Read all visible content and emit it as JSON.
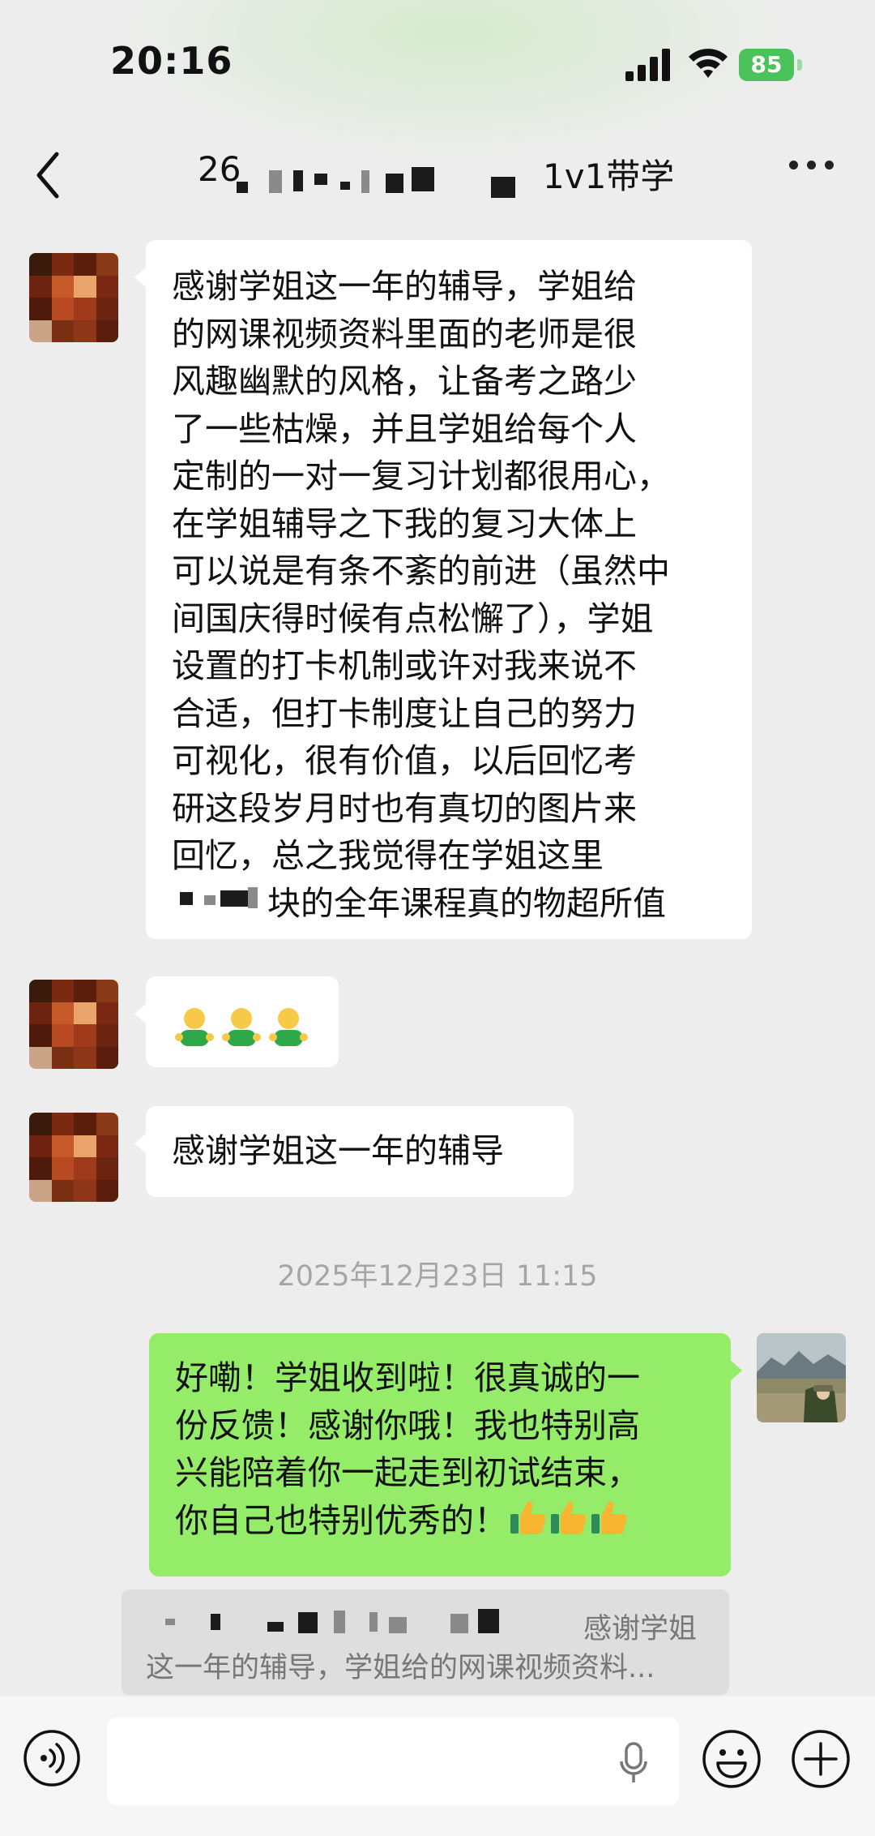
{
  "status_bar": {
    "time": "20:16",
    "battery": "85",
    "icons": [
      "signal-icon",
      "wifi-icon",
      "battery-icon"
    ]
  },
  "nav": {
    "back_icon": "chevron-left-icon",
    "title_prefix": "26",
    "title_suffix": "1v1带学",
    "more_icon": "more-dots-icon"
  },
  "messages": {
    "m1": {
      "lines": [
        "感谢学姐这一年的辅导，学姐给",
        "的网课视频资料里面的老师是很",
        "风趣幽默的风格，让备考之路少",
        "了一些枯燥，并且学姐给每个人",
        "定制的一对一复习计划都很用心，",
        "在学姐辅导之下我的复习大体上",
        "可以说是有条不紊的前进（虽然中",
        "间国庆得时候有点松懈了），学姐",
        "设置的打卡机制或许对我来说不",
        "合适，但打卡制度让自己的努力",
        "可视化，很有价值，以后回忆考",
        "研这段岁月时也有真切的图片来",
        "回忆，总之我觉得在学姐这里",
        "块的全年课程真的物超所值"
      ]
    },
    "m2": {
      "emoji": [
        "person-emoji",
        "person-emoji",
        "person-emoji"
      ]
    },
    "m3": {
      "text": "感谢学姐这一年的辅导"
    },
    "timestamp": "2025年12月23日 11:15",
    "m4": {
      "lines": [
        "好嘞！学姐收到啦！很真诚的一",
        "份反馈！感谢你哦！我也特别高",
        "兴能陪着你一起走到初试结束，",
        "你自己也特别优秀的！"
      ],
      "emoji": [
        "thumbs-up-emoji",
        "thumbs-up-emoji",
        "thumbs-up-emoji"
      ]
    },
    "quote": {
      "line1": "感谢学姐",
      "line2": "这一年的辅导，学姐给的网课视频资料..."
    }
  },
  "input_bar": {
    "icons": [
      "voice-icon",
      "mic-icon",
      "emoji-icon",
      "plus-icon"
    ]
  },
  "colors": {
    "background": "#ededed",
    "incoming_bubble": "#ffffff",
    "outgoing_bubble": "#95ec69",
    "battery": "#4cc35a",
    "timestamp": "#a5a5a5"
  }
}
